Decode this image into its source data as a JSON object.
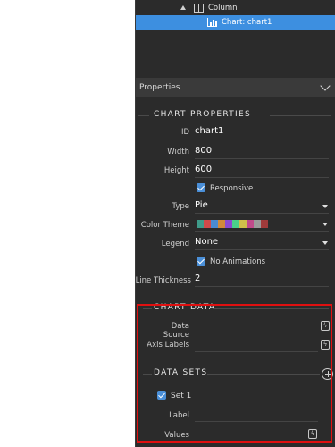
{
  "tree": {
    "column_label": "Column",
    "chart_label": "Chart: chart1"
  },
  "properties_header": "Properties",
  "chart_properties": {
    "title": "CHART PROPERTIES",
    "id_label": "ID",
    "id_value": "chart1",
    "width_label": "Width",
    "width_value": "800",
    "height_label": "Height",
    "height_value": "600",
    "responsive_label": "Responsive",
    "type_label": "Type",
    "type_value": "Pie",
    "color_theme_label": "Color Theme",
    "color_theme_colors": [
      "#3f9b8a",
      "#d04a4a",
      "#4a8ad0",
      "#d08a3a",
      "#8a4ad0",
      "#4ad08a",
      "#d0c04a",
      "#c04a8a",
      "#9a9a9a",
      "#a03a3a"
    ],
    "legend_label": "Legend",
    "legend_value": "None",
    "no_animations_label": "No Animations",
    "line_thickness_label": "Line Thickness",
    "line_thickness_value": "2"
  },
  "chart_data": {
    "title": "CHART DATA",
    "data_source_label": "Data Source",
    "axis_labels_label": "Axis Labels"
  },
  "data_sets": {
    "title": "DATA SETS",
    "set1_label": "Set 1",
    "label_label": "Label",
    "values_label": "Values"
  }
}
